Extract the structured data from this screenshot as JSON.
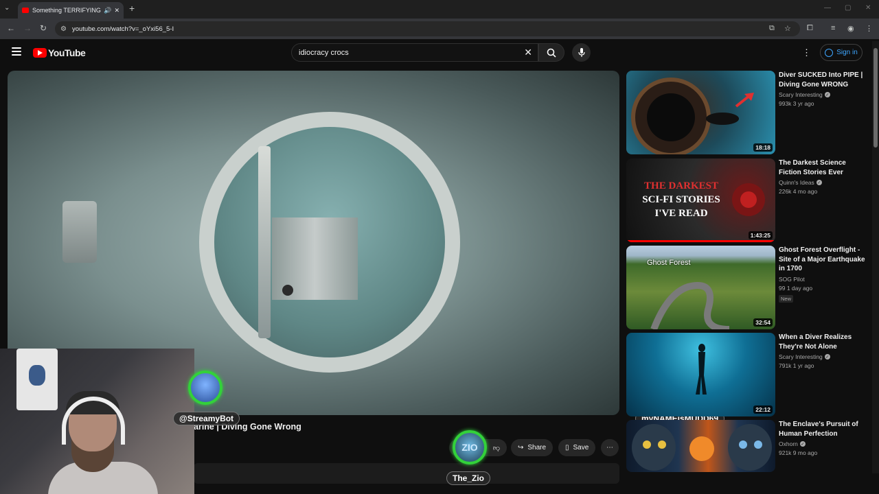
{
  "browser": {
    "tab_title": "Something TERRIFYING Dis",
    "new_tab": "+",
    "url": "youtube.com/watch?v=_oYxi56_5-I",
    "window_controls": {
      "minimize": "—",
      "maximize": "▢",
      "close": "✕"
    }
  },
  "youtube": {
    "logo_text": "YouTube",
    "search_query": "idiocracy crocs",
    "sign_in_label": "Sign in",
    "video_title": "arine | Diving Gone Wrong",
    "actions": {
      "share": "Share",
      "save": "Save"
    }
  },
  "overlays": {
    "bot_name": "@StreamyBot",
    "zio_name": "The_Zio",
    "zio_avatar_text": "ZIO",
    "mudd_name": "myNAMEisMUDD69"
  },
  "recommendations": [
    {
      "title": "Diver SUCKED Into PIPE | Diving Gone WRONG",
      "channel": "Scary Interesting",
      "verified": true,
      "stats": "993k  3 yr ago",
      "duration": "18:18",
      "badge": ""
    },
    {
      "title": "The Darkest Science Fiction Stories Ever",
      "channel": "Quinn's Ideas",
      "verified": true,
      "stats": "226k  4 mo ago",
      "duration": "1:43:25",
      "badge": "",
      "thumb_text": [
        "THE DARKEST",
        "SCI-FI STORIES",
        "I'VE READ"
      ],
      "watched_fraction": 1.0
    },
    {
      "title": "Ghost Forest Overflight - Site of a Major Earthquake in 1700",
      "channel": "SOG Pilot",
      "verified": false,
      "stats": "99  1 day ago",
      "duration": "32:54",
      "badge": "New",
      "thumb_text": [
        "Ghost Forest"
      ]
    },
    {
      "title": "When a Diver Realizes They're Not Alone",
      "channel": "Scary Interesting",
      "verified": true,
      "stats": "791k  1 yr ago",
      "duration": "22:12",
      "badge": ""
    },
    {
      "title": "The Enclave's Pursuit of Human Perfection",
      "channel": "Oxhorn",
      "verified": true,
      "stats": "921k  9 mo ago",
      "duration": "",
      "badge": ""
    }
  ],
  "colors": {
    "accent": "#ff0000",
    "link": "#3ea6ff",
    "overlay_ring": "#33d13a"
  }
}
